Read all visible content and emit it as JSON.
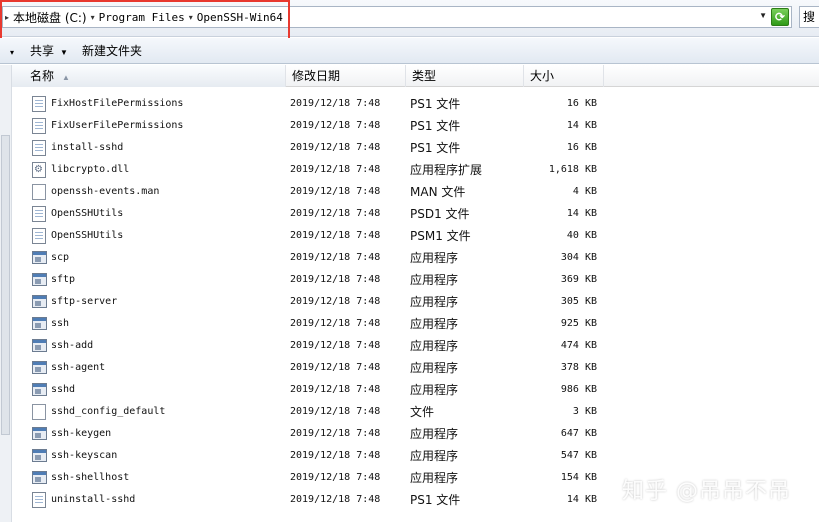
{
  "address": {
    "crumbs": [
      "本地磁盘 (C:)",
      "Program Files",
      "OpenSSH-Win64"
    ],
    "search_placeholder": "搜"
  },
  "toolbar": {
    "share_label": "共享",
    "new_folder_label": "新建文件夹"
  },
  "columns": {
    "name": "名称",
    "date": "修改日期",
    "type": "类型",
    "size": "大小"
  },
  "files": [
    {
      "name": "FixHostFilePermissions",
      "date": "2019/12/18 7:48",
      "type": "PS1 文件",
      "size": "16 KB",
      "icon": "script"
    },
    {
      "name": "FixUserFilePermissions",
      "date": "2019/12/18 7:48",
      "type": "PS1 文件",
      "size": "14 KB",
      "icon": "script"
    },
    {
      "name": "install-sshd",
      "date": "2019/12/18 7:48",
      "type": "PS1 文件",
      "size": "16 KB",
      "icon": "script"
    },
    {
      "name": "libcrypto.dll",
      "date": "2019/12/18 7:48",
      "type": "应用程序扩展",
      "size": "1,618 KB",
      "icon": "dll"
    },
    {
      "name": "openssh-events.man",
      "date": "2019/12/18 7:48",
      "type": "MAN 文件",
      "size": "4 KB",
      "icon": "plain"
    },
    {
      "name": "OpenSSHUtils",
      "date": "2019/12/18 7:48",
      "type": "PSD1 文件",
      "size": "14 KB",
      "icon": "script"
    },
    {
      "name": "OpenSSHUtils",
      "date": "2019/12/18 7:48",
      "type": "PSM1 文件",
      "size": "40 KB",
      "icon": "script"
    },
    {
      "name": "scp",
      "date": "2019/12/18 7:48",
      "type": "应用程序",
      "size": "304 KB",
      "icon": "exe"
    },
    {
      "name": "sftp",
      "date": "2019/12/18 7:48",
      "type": "应用程序",
      "size": "369 KB",
      "icon": "exe"
    },
    {
      "name": "sftp-server",
      "date": "2019/12/18 7:48",
      "type": "应用程序",
      "size": "305 KB",
      "icon": "exe"
    },
    {
      "name": "ssh",
      "date": "2019/12/18 7:48",
      "type": "应用程序",
      "size": "925 KB",
      "icon": "exe"
    },
    {
      "name": "ssh-add",
      "date": "2019/12/18 7:48",
      "type": "应用程序",
      "size": "474 KB",
      "icon": "exe"
    },
    {
      "name": "ssh-agent",
      "date": "2019/12/18 7:48",
      "type": "应用程序",
      "size": "378 KB",
      "icon": "exe"
    },
    {
      "name": "sshd",
      "date": "2019/12/18 7:48",
      "type": "应用程序",
      "size": "986 KB",
      "icon": "exe"
    },
    {
      "name": "sshd_config_default",
      "date": "2019/12/18 7:48",
      "type": "文件",
      "size": "3 KB",
      "icon": "plain"
    },
    {
      "name": "ssh-keygen",
      "date": "2019/12/18 7:48",
      "type": "应用程序",
      "size": "647 KB",
      "icon": "exe"
    },
    {
      "name": "ssh-keyscan",
      "date": "2019/12/18 7:48",
      "type": "应用程序",
      "size": "547 KB",
      "icon": "exe"
    },
    {
      "name": "ssh-shellhost",
      "date": "2019/12/18 7:48",
      "type": "应用程序",
      "size": "154 KB",
      "icon": "exe"
    },
    {
      "name": "uninstall-sshd",
      "date": "2019/12/18 7:48",
      "type": "PS1 文件",
      "size": "14 KB",
      "icon": "script"
    }
  ],
  "watermark": "知乎 @吊吊不吊"
}
